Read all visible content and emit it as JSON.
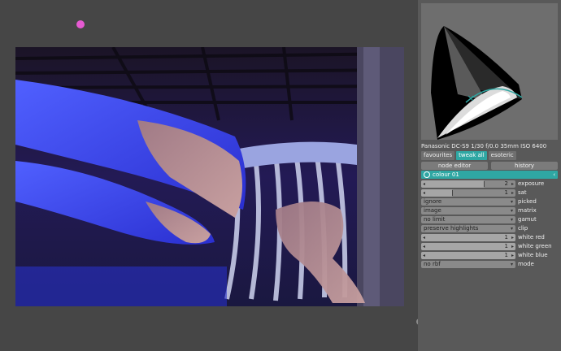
{
  "camera_info": "Panasonic DC-S9 1/30 f/0.0 35mm ISO 6400",
  "tabs": [
    {
      "label": "favourites",
      "active": false
    },
    {
      "label": "tweak all",
      "active": true
    },
    {
      "label": "esoteric",
      "active": false
    }
  ],
  "buttons": {
    "node_editor": "node editor",
    "history": "history"
  },
  "module": {
    "name": "colour 01",
    "expand_icon": "chevron-left-icon"
  },
  "params": [
    {
      "type": "slider",
      "label": "exposure",
      "value": "2",
      "fraction": 0.66
    },
    {
      "type": "slider",
      "label": "sat",
      "value": "1",
      "fraction": 0.33
    },
    {
      "type": "combo",
      "label": "picked",
      "value": "ignore"
    },
    {
      "type": "combo",
      "label": "matrix",
      "value": "image"
    },
    {
      "type": "combo",
      "label": "gamut",
      "value": "no limit"
    },
    {
      "type": "combo",
      "label": "clip",
      "value": "preserve highlights"
    },
    {
      "type": "slider",
      "label": "white red",
      "value": "1",
      "fraction": 1.0
    },
    {
      "type": "slider",
      "label": "white green",
      "value": "1",
      "fraction": 1.0
    },
    {
      "type": "slider",
      "label": "white blue",
      "value": "1",
      "fraction": 1.0
    },
    {
      "type": "combo",
      "label": "mode",
      "value": "no rbf"
    }
  ],
  "colors": {
    "accent": "#2fa7a3",
    "panel": "#595959",
    "background": "#464646",
    "pick_marker": "#e65ad2"
  }
}
